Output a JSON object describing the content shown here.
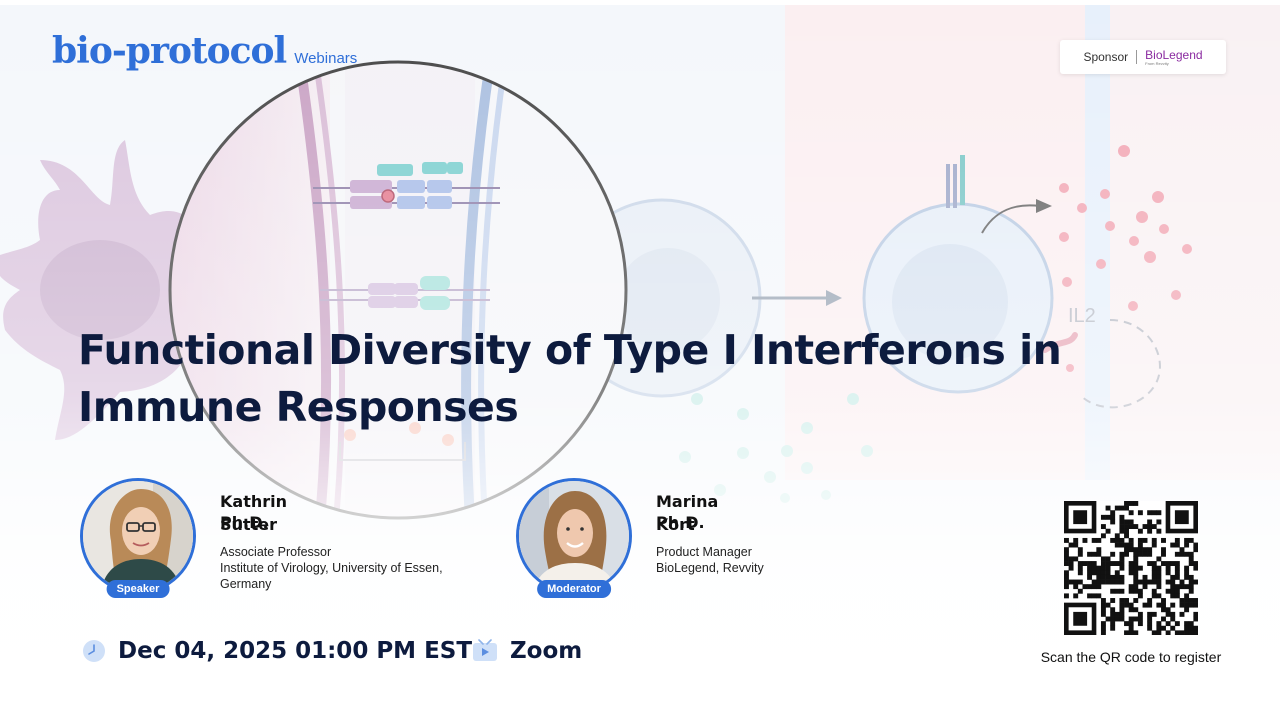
{
  "brand": {
    "name": "bio-protocol",
    "section": "Webinars"
  },
  "sponsor": {
    "label": "Sponsor",
    "name": "BioLegend",
    "tagline": "From Revvity"
  },
  "illustration": {
    "cytokine_label": "IL2"
  },
  "title": "Functional Diversity of Type I Interferons in Immune Responses",
  "speaker": {
    "name": "Kathrin Sutter",
    "degree": "Ph.D.",
    "position": "Associate Professor",
    "affiliation": "Institute of Virology, University of Essen, Germany",
    "role": "Speaker"
  },
  "moderator": {
    "name": "Marina Kort",
    "degree": "Ph.D.",
    "position": "Product Manager",
    "affiliation": "BioLegend, Revvity",
    "role": "Moderator"
  },
  "event": {
    "datetime": "Dec 04, 2025 01:00 PM EST",
    "platform": "Zoom"
  },
  "qr": {
    "caption": "Scan the QR code to register"
  },
  "colors": {
    "accent": "#2f6fd8",
    "title": "#0d1b3e",
    "sponsor_brand": "#8a2aa0"
  },
  "icons": {
    "date": "clock-icon",
    "platform": "video-icon"
  }
}
